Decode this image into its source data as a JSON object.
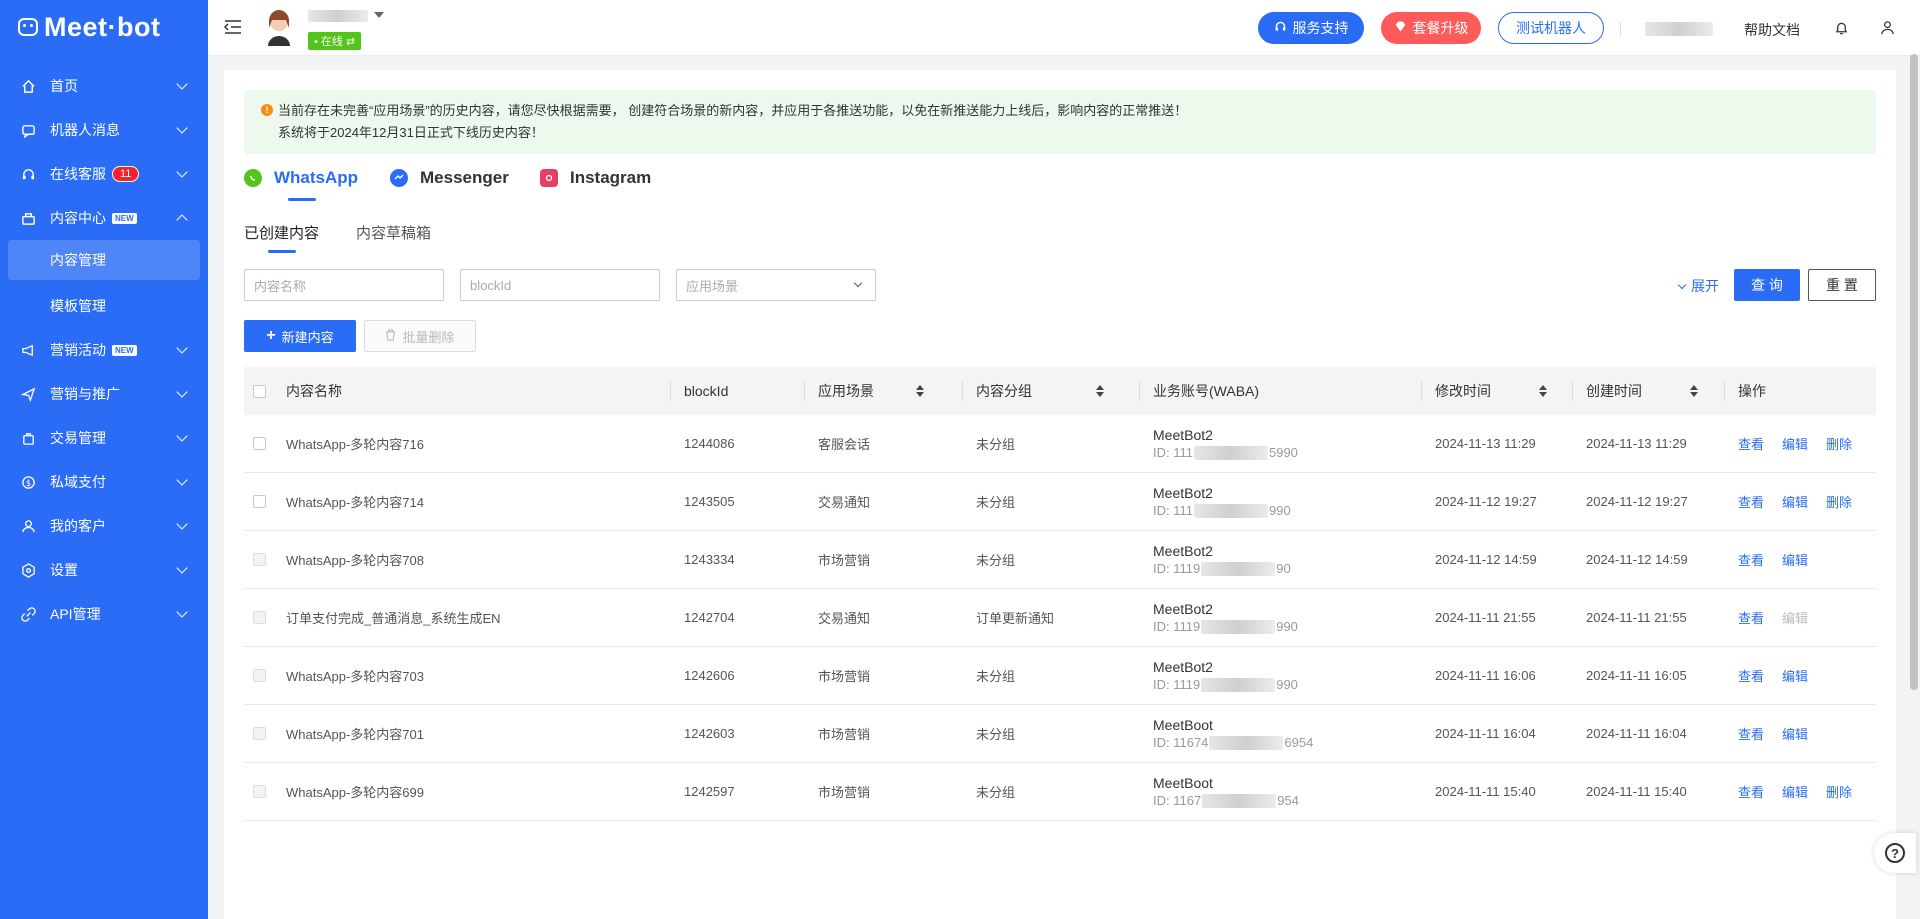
{
  "sidebar": {
    "logo": "Meet·bot",
    "items": [
      {
        "label": "首页"
      },
      {
        "label": "机器人消息"
      },
      {
        "label": "在线客服",
        "badge": "11"
      },
      {
        "label": "内容中心",
        "tag": "NEW"
      },
      {
        "label": "营销活动",
        "tag": "NEW"
      },
      {
        "label": "营销与推广"
      },
      {
        "label": "交易管理"
      },
      {
        "label": "私域支付"
      },
      {
        "label": "我的客户"
      },
      {
        "label": "设置"
      },
      {
        "label": "API管理"
      }
    ],
    "subitems": [
      {
        "label": "内容管理"
      },
      {
        "label": "模板管理"
      }
    ]
  },
  "header": {
    "status": "• 在线 ⇄",
    "btn_support": "服务支持",
    "btn_upgrade": "套餐升级",
    "btn_test": "测试机器人",
    "help_docs": "帮助文档"
  },
  "notice": {
    "line1": "当前存在未完善“应用场景”的历史内容，请您尽快根据需要， 创建符合场景的新内容，并应用于各推送功能，以免在新推送能力上线后，影响内容的正常推送！",
    "line2": "系统将于2024年12月31日正式下线历史内容！"
  },
  "channels": [
    "WhatsApp",
    "Messenger",
    "Instagram"
  ],
  "tabs": [
    "已创建内容",
    "内容草稿箱"
  ],
  "filters": {
    "name_placeholder": "内容名称",
    "blockid_placeholder": "blockId",
    "scene_placeholder": "应用场景",
    "expand": "展开",
    "query": "查 询",
    "reset": "重 置"
  },
  "actions": {
    "new": "新建内容",
    "batch_delete": "批量删除"
  },
  "table": {
    "columns": [
      "内容名称",
      "blockId",
      "应用场景",
      "内容分组",
      "业务账号(WABA)",
      "修改时间",
      "创建时间",
      "操作"
    ],
    "ops": {
      "view": "查看",
      "edit": "编辑",
      "delete": "删除"
    },
    "rows": [
      {
        "name": "WhatsApp-多轮内容716",
        "blockId": "1244086",
        "scene": "客服会话",
        "group": "未分组",
        "acct": "MeetBot2",
        "id_pre": "ID: 111",
        "id_post": "5990",
        "modified": "2024-11-13 11:29",
        "created": "2024-11-13 11:29"
      },
      {
        "name": "WhatsApp-多轮内容714",
        "blockId": "1243505",
        "scene": "交易通知",
        "group": "未分组",
        "acct": "MeetBot2",
        "id_pre": "ID: 111",
        "id_post": "990",
        "modified": "2024-11-12 19:27",
        "created": "2024-11-12 19:27"
      },
      {
        "name": "WhatsApp-多轮内容708",
        "blockId": "1243334",
        "scene": "市场营销",
        "group": "未分组",
        "acct": "MeetBot2",
        "id_pre": "ID: 1119",
        "id_post": "90",
        "modified": "2024-11-12 14:59",
        "created": "2024-11-12 14:59"
      },
      {
        "name": "订单支付完成_普通消息_系统生成EN",
        "blockId": "1242704",
        "scene": "交易通知",
        "group": "订单更新通知",
        "acct": "MeetBot2",
        "id_pre": "ID: 1119",
        "id_post": "990",
        "modified": "2024-11-11 21:55",
        "created": "2024-11-11 21:55"
      },
      {
        "name": "WhatsApp-多轮内容703",
        "blockId": "1242606",
        "scene": "市场营销",
        "group": "未分组",
        "acct": "MeetBot2",
        "id_pre": "ID: 1119",
        "id_post": "990",
        "modified": "2024-11-11 16:06",
        "created": "2024-11-11 16:05"
      },
      {
        "name": "WhatsApp-多轮内容701",
        "blockId": "1242603",
        "scene": "市场营销",
        "group": "未分组",
        "acct": "MeetBoot",
        "id_pre": "ID: 11674",
        "id_post": "6954",
        "modified": "2024-11-11 16:04",
        "created": "2024-11-11 16:04"
      },
      {
        "name": "WhatsApp-多轮内容699",
        "blockId": "1242597",
        "scene": "市场营销",
        "group": "未分组",
        "acct": "MeetBoot",
        "id_pre": "ID: 1167",
        "id_post": "954",
        "modified": "2024-11-11 15:40",
        "created": "2024-11-11 15:40"
      }
    ]
  },
  "colors": {
    "primary": "#2a6cf6",
    "danger": "#ff5b5b",
    "success": "#52c41a",
    "notice_bg": "#ecf9ec"
  }
}
